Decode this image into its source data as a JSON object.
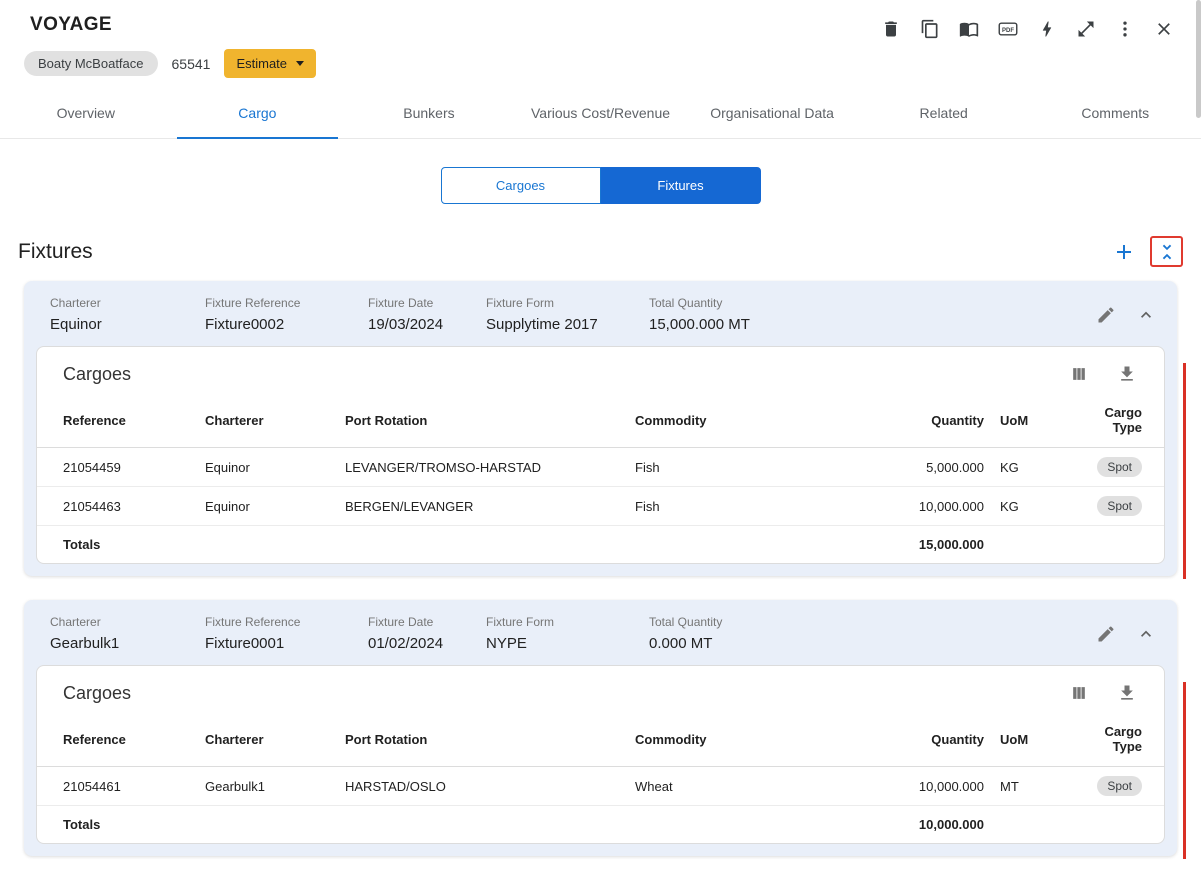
{
  "colors": {
    "accent_blue": "#1976d2",
    "toggle_fill_blue": "#1568d3",
    "estimate_yellow": "#f0b42e",
    "alert_red": "#d93025",
    "fixture_header_bg": "#e9eff9"
  },
  "header": {
    "title": "VOYAGE",
    "vessel_chip": "Boaty McBoatface",
    "voyage_number": "65541",
    "estimate_label": "Estimate",
    "pdf_icon_label": "PDF"
  },
  "tabs": {
    "active": "Cargo",
    "items": [
      {
        "label": "Overview"
      },
      {
        "label": "Cargo"
      },
      {
        "label": "Bunkers"
      },
      {
        "label": "Various Cost/Revenue"
      },
      {
        "label": "Organisational Data"
      },
      {
        "label": "Related"
      },
      {
        "label": "Comments"
      }
    ]
  },
  "view_toggle": {
    "selected": "Fixtures",
    "cargoes_label": "Cargoes",
    "fixtures_label": "Fixtures"
  },
  "fixtures_section": {
    "title": "Fixtures"
  },
  "fixture_labels": {
    "charterer": "Charterer",
    "fixture_reference": "Fixture Reference",
    "fixture_date": "Fixture Date",
    "fixture_form": "Fixture Form",
    "total_quantity": "Total Quantity"
  },
  "table": {
    "headers": [
      "Reference",
      "Charterer",
      "Port Rotation",
      "Commodity",
      "Quantity",
      "UoM",
      "Cargo Type"
    ],
    "totals_label": "Totals"
  },
  "fixtures": [
    {
      "charterer": "Equinor",
      "fixture_reference": "Fixture0002",
      "fixture_date": "19/03/2024",
      "fixture_form": "Supplytime 2017",
      "total_quantity": "15,000.000 MT",
      "cargoes_title": "Cargoes",
      "rows": [
        {
          "reference": "21054459",
          "charterer": "Equinor",
          "port_rotation": "LEVANGER/TROMSO-HARSTAD",
          "commodity": "Fish",
          "quantity": "5,000.000",
          "uom": "KG",
          "cargo_type": "Spot"
        },
        {
          "reference": "21054463",
          "charterer": "Equinor",
          "port_rotation": "BERGEN/LEVANGER",
          "commodity": "Fish",
          "quantity": "10,000.000",
          "uom": "KG",
          "cargo_type": "Spot"
        }
      ],
      "totals_quantity": "15,000.000"
    },
    {
      "charterer": "Gearbulk1",
      "fixture_reference": "Fixture0001",
      "fixture_date": "01/02/2024",
      "fixture_form": "NYPE",
      "total_quantity": "0.000 MT",
      "cargoes_title": "Cargoes",
      "rows": [
        {
          "reference": "21054461",
          "charterer": "Gearbulk1",
          "port_rotation": "HARSTAD/OSLO",
          "commodity": "Wheat",
          "quantity": "10,000.000",
          "uom": "MT",
          "cargo_type": "Spot"
        }
      ],
      "totals_quantity": "10,000.000"
    }
  ]
}
